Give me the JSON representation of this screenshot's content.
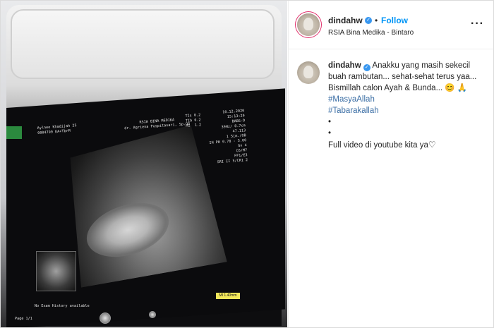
{
  "post": {
    "username": "dindahw",
    "follow_separator": "•",
    "follow_label": "Follow",
    "location": "RSIA Bina Medika - Bintaro",
    "more_icon": "more-horizontal-icon",
    "caption": {
      "username": "dindahw",
      "text_1": "Anakku yang masih sekecil buah rambutan... sehat-sehat terus yaa... Bismillah calon Ayah & Bunda...",
      "emoji_1": "😊",
      "emoji_2": "🙏",
      "hashtag_1": "#MasyaAllah",
      "hashtag_2": "#Tabarakallah",
      "bullet_1": "•",
      "bullet_2": "•",
      "text_2": "Full video di youtube kita ya",
      "heart": "♡"
    }
  },
  "ultrasound": {
    "patient_line_1": "Aylnee Khadijah 25",
    "patient_line_2": "0004799 EA+TbrM",
    "facility_line_1": "RSIA BINA MEDIKA",
    "facility_line_2": "dr. Agriena Puspitasari, Sp.OG",
    "ti_values": "TIs 0.2\nTIb 0.2\nMI  1.2",
    "date_block": "10.12.2020\n15:13:29\nBABS-D\n39Hz/ 8.7cm\n47.113\n1 Sim./OB\nIH PH 0.78 - 3.00\nGn 4\nC6/M7\nFF1/E3\nSRI II 5/CRI 2",
    "tag_mi": "MI 1.40mm",
    "bottom_left": "No Exam History available",
    "bottom_right": "Page 1/1"
  },
  "colors": {
    "follow_blue": "#0095f6",
    "verified_blue": "#3897f0",
    "hashtag": "#3b6ea5",
    "text": "#262626",
    "border": "#dbdbdb"
  }
}
